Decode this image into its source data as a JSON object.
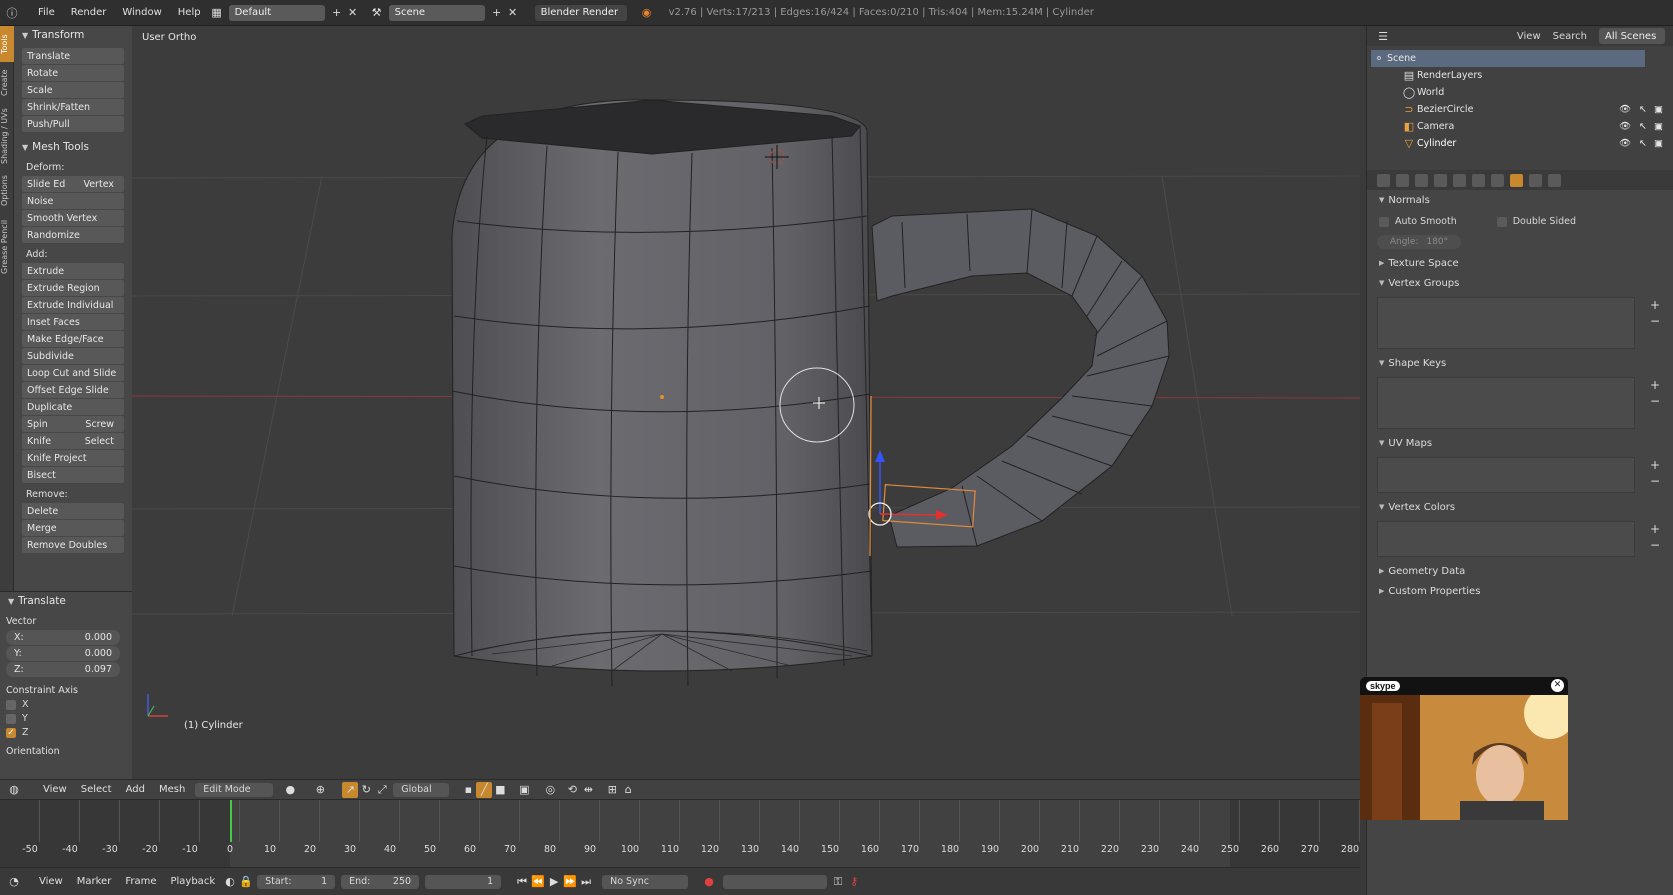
{
  "menubar": {
    "file": "File",
    "render": "Render",
    "window": "Window",
    "help": "Help",
    "screen_layout": "Default",
    "scene": "Scene",
    "render_engine": "Blender Render",
    "stats": "v2.76 | Verts:17/213 | Edges:16/424 | Faces:0/210 | Tris:404 | Mem:15.24M | Cylinder"
  },
  "vertical_tabs": [
    "Tools",
    "Create",
    "Shading / UVs",
    "Options",
    "Grease Pencil"
  ],
  "toolshelf": {
    "transform_header": "Transform",
    "transform": [
      "Translate",
      "Rotate",
      "Scale",
      "Shrink/Fatten",
      "Push/Pull"
    ],
    "mesh_tools_header": "Mesh Tools",
    "deform_label": "Deform:",
    "slide_edge": "Slide Ed",
    "vertex": "Vertex",
    "deform": [
      "Noise",
      "Smooth Vertex",
      "Randomize"
    ],
    "add_label": "Add:",
    "add": [
      "Extrude",
      "Extrude Region",
      "Extrude Individual",
      "Inset Faces",
      "Make Edge/Face",
      "Subdivide",
      "Loop Cut and Slide",
      "Offset Edge Slide",
      "Duplicate"
    ],
    "spin": "Spin",
    "screw": "Screw",
    "knife": "Knife",
    "select": "Select",
    "knife_project": "Knife Project",
    "bisect": "Bisect",
    "remove_label": "Remove:",
    "delete": "Delete",
    "merge": "Merge",
    "remove_doubles": "Remove Doubles"
  },
  "redo_panel": {
    "header": "Translate",
    "vector_label": "Vector",
    "x_label": "X:",
    "x_value": "0.000",
    "y_label": "Y:",
    "y_value": "0.000",
    "z_label": "Z:",
    "z_value": "0.097",
    "constraint_label": "Constraint Axis",
    "axis_x": "X",
    "axis_y": "Y",
    "axis_z": "Z",
    "axis_z_checked": true,
    "orientation_label": "Orientation"
  },
  "viewport": {
    "view_label": "User Ortho",
    "object_label": "(1) Cylinder"
  },
  "header3d": {
    "view": "View",
    "select": "Select",
    "add": "Add",
    "mesh": "Mesh",
    "mode": "Edit Mode",
    "orientation": "Global"
  },
  "timeline": {
    "ruler": [
      "-50",
      "-40",
      "-30",
      "-20",
      "-10",
      "0",
      "10",
      "20",
      "30",
      "40",
      "50",
      "60",
      "70",
      "80",
      "90",
      "100",
      "110",
      "120",
      "130",
      "140",
      "150",
      "160",
      "170",
      "180",
      "190",
      "200",
      "210",
      "220",
      "230",
      "240",
      "250",
      "260",
      "270",
      "280"
    ],
    "current_frame": 0,
    "view": "View",
    "marker": "Marker",
    "frame": "Frame",
    "playback": "Playback",
    "start_label": "Start:",
    "start_value": "1",
    "end_label": "End:",
    "end_value": "250",
    "frame_value": "1",
    "sync": "No Sync"
  },
  "outliner": {
    "view": "View",
    "search": "Search",
    "all_scenes": "All Scenes",
    "items": [
      "Scene",
      "RenderLayers",
      "World",
      "BezierCircle",
      "Camera",
      "Cylinder"
    ]
  },
  "properties": {
    "normals": "Normals",
    "auto_smooth": "Auto Smooth",
    "double_sided": "Double Sided",
    "angle_label": "Angle:",
    "angle_value": "180°",
    "texture_space": "Texture Space",
    "vertex_groups": "Vertex Groups",
    "shape_keys": "Shape Keys",
    "uv_maps": "UV Maps",
    "vertex_colors": "Vertex Colors",
    "geometry_data": "Geometry Data",
    "custom_properties": "Custom Properties"
  },
  "webcam": {
    "logo": "skype"
  },
  "colors": {
    "accent": "#c8882e",
    "background": "#3c3c3c",
    "panel": "#474747"
  }
}
